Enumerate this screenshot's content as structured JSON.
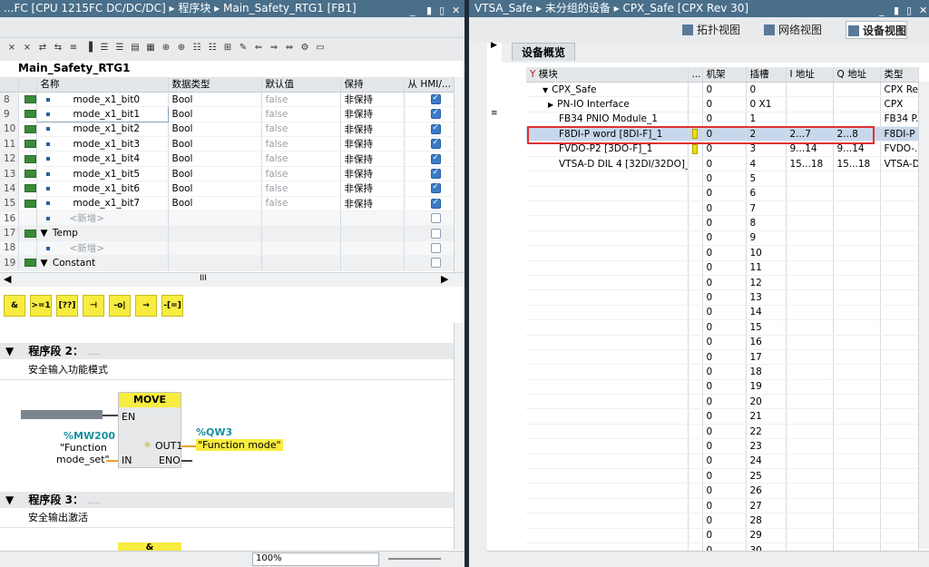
{
  "left_title": "...FC [CPU 1215FC DC/DC/DC]  ▸  程序块  ▸  Main_Safety_RTG1 [FB1]",
  "right_title": "VTSA_Safe  ▸  未分组的设备  ▸  CPX_Safe [CPX Rev 30]",
  "window_ctrl": {
    "min": "_",
    "restore": "▮",
    "max": "▯",
    "close": "✕"
  },
  "block_name": "Main_Safety_RTG1",
  "interface": {
    "headers": [
      "名称",
      "数据类型",
      "默认值",
      "保持",
      "从 HMI/..."
    ],
    "rows": [
      {
        "num": "8",
        "name": "mode_x1_bit0",
        "type": "Bool",
        "default": "false",
        "retain": "非保持",
        "hmi": true
      },
      {
        "num": "9",
        "name": "mode_x1_bit1",
        "type": "Bool",
        "default": "false",
        "retain": "非保持",
        "hmi": true
      },
      {
        "num": "10",
        "name": "mode_x1_bit2",
        "type": "Bool",
        "default": "false",
        "retain": "非保持",
        "hmi": true
      },
      {
        "num": "11",
        "name": "mode_x1_bit3",
        "type": "Bool",
        "default": "false",
        "retain": "非保持",
        "hmi": true
      },
      {
        "num": "12",
        "name": "mode_x1_bit4",
        "type": "Bool",
        "default": "false",
        "retain": "非保持",
        "hmi": true
      },
      {
        "num": "13",
        "name": "mode_x1_bit5",
        "type": "Bool",
        "default": "false",
        "retain": "非保持",
        "hmi": true
      },
      {
        "num": "14",
        "name": "mode_x1_bit6",
        "type": "Bool",
        "default": "false",
        "retain": "非保持",
        "hmi": true
      },
      {
        "num": "15",
        "name": "mode_x1_bit7",
        "type": "Bool",
        "default": "false",
        "retain": "非保持",
        "hmi": true
      },
      {
        "num": "16",
        "name": "<新增>",
        "type": "",
        "default": "",
        "retain": "",
        "hmi": false
      },
      {
        "num": "17",
        "name": "Temp",
        "type": "",
        "default": "",
        "retain": "",
        "hmi": false
      },
      {
        "num": "18",
        "name": "<新增>",
        "type": "",
        "default": "",
        "retain": "",
        "hmi": false
      },
      {
        "num": "19",
        "name": "Constant",
        "type": "",
        "default": "",
        "retain": "",
        "hmi": false
      }
    ]
  },
  "hscroll_mark": "III",
  "ladder_buttons": [
    "&",
    ">=1",
    "[??]",
    "⊣",
    "-o|",
    "→",
    "-[=]"
  ],
  "networks": [
    {
      "label": "程序段 2：",
      "dots": ".....",
      "comment": "安全输入功能模式"
    },
    {
      "label": "程序段 3：",
      "dots": ".....",
      "comment": "安全输出激活"
    }
  ],
  "move_block": {
    "title": "MOVE",
    "en": "EN",
    "in": "IN",
    "out1": "OUT1",
    "eno": "ENO",
    "in_addr": "%MW200",
    "in_sym1": "\"Function",
    "in_sym2": "mode_set\"",
    "out_addr": "%QW3",
    "out_sym": "\"Function mode\""
  },
  "and_block": "&",
  "zoom": "100%",
  "view_buttons": [
    "拓扑视图",
    "网络视图",
    "设备视图"
  ],
  "device_tab": "设备概览",
  "device": {
    "headers": [
      "模块",
      "...",
      "机架",
      "插槽",
      "I 地址",
      "Q 地址",
      "类型"
    ],
    "rows": [
      {
        "module": "CPX_Safe",
        "indent": 1,
        "arrow": "▼",
        "rack": "0",
        "slot": "0",
        "i": "",
        "q": "",
        "type": "CPX Re..."
      },
      {
        "module": "PN-IO Interface",
        "indent": 2,
        "arrow": "▶",
        "rack": "0",
        "slot": "0 X1",
        "i": "",
        "q": "",
        "type": "CPX"
      },
      {
        "module": "FB34 PNIO Module_1",
        "indent": 1,
        "arrow": "",
        "rack": "0",
        "slot": "1",
        "i": "",
        "q": "",
        "type": "FB34 P..."
      },
      {
        "module": "F8DI-P word [8DI-F]_1",
        "indent": 1,
        "arrow": "",
        "rack": "0",
        "slot": "2",
        "i": "2...7",
        "q": "2...8",
        "type": "F8DI-P ...",
        "sel": true,
        "y": true
      },
      {
        "module": "FVDO-P2 [3DO-F]_1",
        "indent": 1,
        "arrow": "",
        "rack": "0",
        "slot": "3",
        "i": "9...14",
        "q": "9...14",
        "type": "FVDO-...",
        "y": true
      },
      {
        "module": "VTSA-D DIL 4 [32DI/32DO]_1",
        "indent": 1,
        "arrow": "",
        "rack": "0",
        "slot": "4",
        "i": "15...18",
        "q": "15...18",
        "type": "VTSA-D..."
      }
    ],
    "empty_slots": [
      "5",
      "6",
      "7",
      "8",
      "9",
      "10",
      "11",
      "12",
      "13",
      "14",
      "15",
      "16",
      "17",
      "18",
      "19",
      "20",
      "21",
      "22",
      "23",
      "24",
      "25",
      "26",
      "27",
      "28",
      "29",
      "30"
    ]
  }
}
